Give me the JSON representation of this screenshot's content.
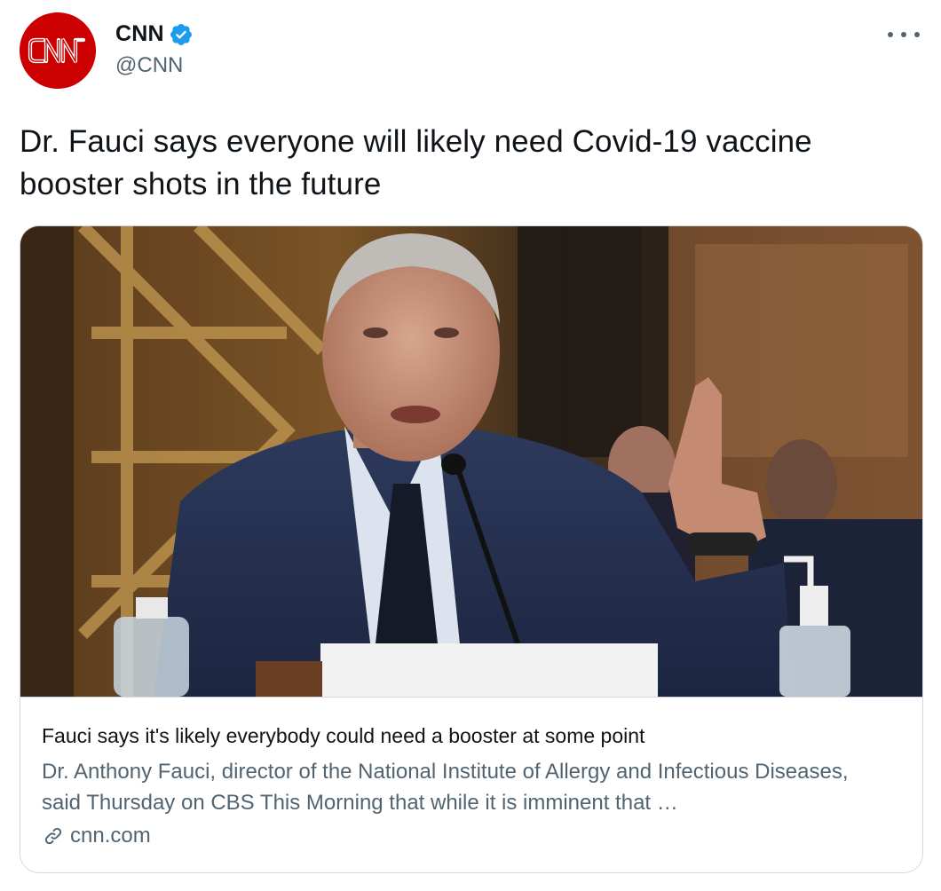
{
  "author": {
    "display_name": "CNN",
    "handle": "@CNN",
    "avatar_text": "CNN",
    "verified": true
  },
  "tweet": {
    "text": "Dr. Fauci says everyone will likely need Covid-19 vaccine booster shots in the future"
  },
  "card": {
    "image_icon": "news-photo",
    "title": "Fauci says it's likely everybody could need a booster at some point",
    "description": "Dr. Anthony Fauci, director of the National Institute of Allergy and Infectious Diseases, said Thursday on CBS This Morning that while it is imminent that …",
    "domain": "cnn.com"
  },
  "colors": {
    "brand_red": "#cc0000",
    "verified_blue": "#1d9bf0",
    "secondary_text": "#536471",
    "border": "#cfd9de"
  }
}
